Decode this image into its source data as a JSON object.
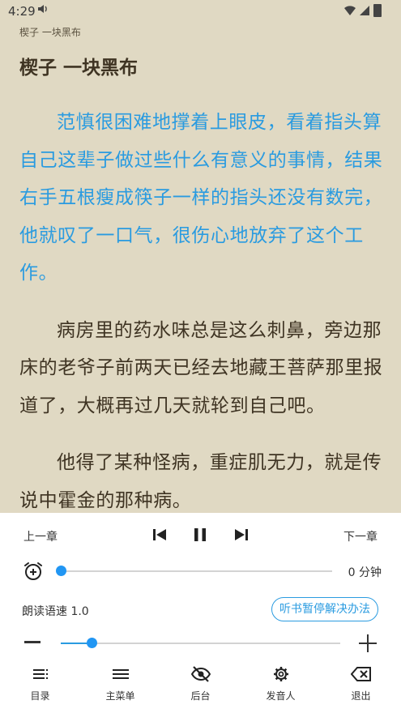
{
  "status_bar": {
    "time": "4:29"
  },
  "book": {
    "header_title": "楔子 一块黑布",
    "chapter_title": "楔子 一块黑布",
    "paragraphs": [
      "范慎很困难地撑着上眼皮，看着指头算自己这辈子做过些什么有意义的事情，结果右手五根瘦成筷子一样的指头还没有数完，他就叹了一口气，很伤心地放弃了这个工作。",
      "病房里的药水味总是这么刺鼻，旁边那床的老爷子前两天已经去地藏王菩萨那里报道了，大概再过几天就轮到自己吧。",
      "他得了某种怪病，重症肌无力，就是传说中霍金的那种病。"
    ],
    "reading_paragraph_index": 0
  },
  "reader_panel": {
    "prev_chapter_label": "上一章",
    "next_chapter_label": "下一章",
    "timer": {
      "value_label": "0 分钟",
      "fraction": 0.0
    },
    "speed": {
      "label": "朗读语速 1.0",
      "fraction": 0.11
    },
    "help_button_label": "听书暂停解决办法"
  },
  "bottom_nav": [
    {
      "label": "目录",
      "icon": "toc-icon"
    },
    {
      "label": "主菜单",
      "icon": "menu-icon"
    },
    {
      "label": "后台",
      "icon": "eye-off-icon"
    },
    {
      "label": "发音人",
      "icon": "gear-icon"
    },
    {
      "label": "退出",
      "icon": "backspace-icon"
    }
  ],
  "colors": {
    "page_background": "#e0d9c3",
    "text": "#3f3423",
    "reading_highlight": "#2a9be0",
    "accent": "#2196f3"
  }
}
